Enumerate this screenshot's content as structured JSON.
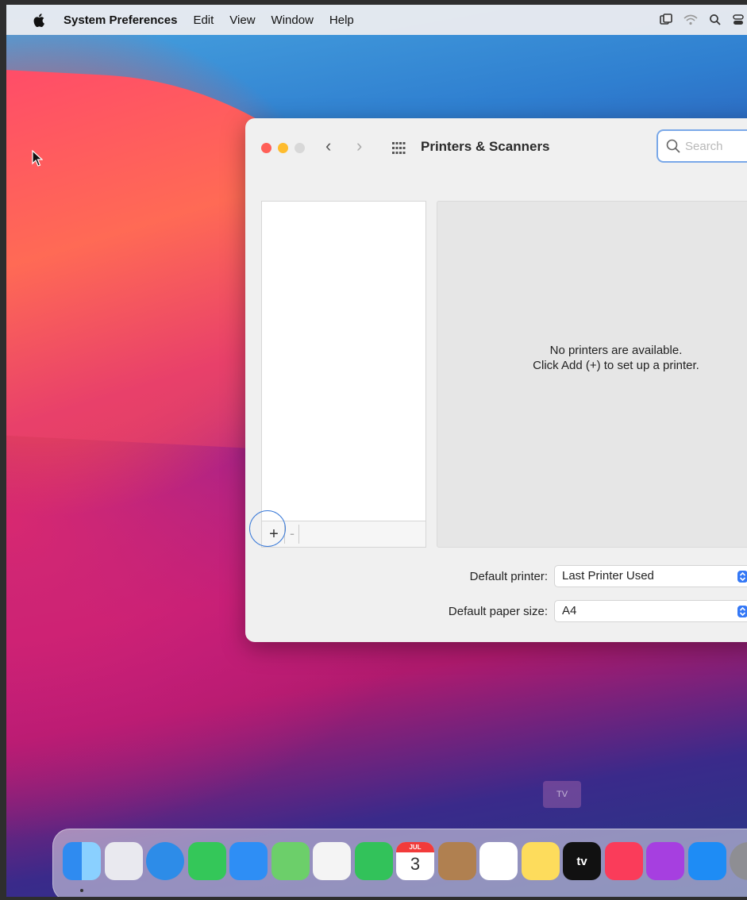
{
  "menubar": {
    "app_name": "System Preferences",
    "items": [
      "Edit",
      "View",
      "Window",
      "Help"
    ]
  },
  "window": {
    "title": "Printers & Scanners",
    "search": {
      "placeholder": "Search",
      "value": ""
    },
    "list": {
      "add_label": "+",
      "remove_label": "-"
    },
    "empty_message": {
      "line1": "No printers are available.",
      "line2": "Click Add (+) to set up a printer."
    },
    "default_printer": {
      "label": "Default printer:",
      "value": "Last Printer Used"
    },
    "default_paper": {
      "label": "Default paper size:",
      "value": "A4"
    }
  },
  "dock": {
    "tooltip": "TV",
    "calendar": {
      "month": "JUL",
      "day": "3"
    },
    "tv_label": "tv",
    "items": [
      {
        "name": "finder-icon",
        "color": "#2f8bf0"
      },
      {
        "name": "launchpad-icon",
        "color": "#e8e8ee"
      },
      {
        "name": "safari-icon",
        "color": "#2d8ce8"
      },
      {
        "name": "messages-icon",
        "color": "#34c759"
      },
      {
        "name": "mail-icon",
        "color": "#2e8ef5"
      },
      {
        "name": "maps-icon",
        "color": "#6ccf6a"
      },
      {
        "name": "photos-icon",
        "color": "#f4f4f4"
      },
      {
        "name": "facetime-icon",
        "color": "#32c25a"
      },
      {
        "name": "calendar-icon",
        "color": "#ffffff"
      },
      {
        "name": "contacts-icon",
        "color": "#b08050"
      },
      {
        "name": "reminders-icon",
        "color": "#ffffff"
      },
      {
        "name": "notes-icon",
        "color": "#fddc5c"
      },
      {
        "name": "tv-icon",
        "color": "#111111"
      },
      {
        "name": "music-icon",
        "color": "#fa3c5a"
      },
      {
        "name": "podcasts-icon",
        "color": "#a63fe0"
      },
      {
        "name": "app-store-icon",
        "color": "#1e8cf5"
      },
      {
        "name": "system-preferences-icon",
        "color": "#8e8e93"
      }
    ]
  }
}
